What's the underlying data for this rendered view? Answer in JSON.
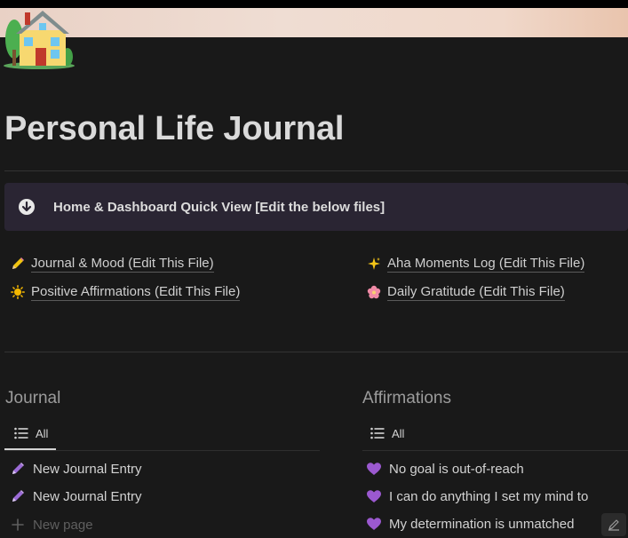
{
  "page": {
    "title": "Personal Life Journal",
    "icon": "house-icon"
  },
  "callout": {
    "icon": "arrow-down-circle-icon",
    "text": "Home & Dashboard Quick View [Edit the below files]"
  },
  "links": [
    {
      "icon": "pencil-icon",
      "label": "Journal & Mood (Edit This File)"
    },
    {
      "icon": "sparkles-icon",
      "label": "Aha Moments Log (Edit This File)"
    },
    {
      "icon": "sun-icon",
      "label": "Positive Affirmations (Edit This File)"
    },
    {
      "icon": "flower-icon",
      "label": "Daily Gratitude (Edit This File)"
    }
  ],
  "journal": {
    "title": "Journal",
    "view_label": "All",
    "items": [
      {
        "icon": "pencil-icon",
        "label": "New Journal Entry"
      },
      {
        "icon": "pencil-icon",
        "label": "New Journal Entry"
      }
    ],
    "new_page_label": "New page"
  },
  "affirmations": {
    "title": "Affirmations",
    "view_label": "All",
    "items": [
      {
        "icon": "purple-heart-icon",
        "label": "No goal is out-of-reach"
      },
      {
        "icon": "purple-heart-icon",
        "label": "I can do anything I set my mind to"
      },
      {
        "icon": "purple-heart-icon",
        "label": "My determination is unmatched"
      }
    ]
  },
  "colors": {
    "background": "#191919",
    "callout_bg": "#2a2533",
    "heart": "#9b59d0"
  }
}
